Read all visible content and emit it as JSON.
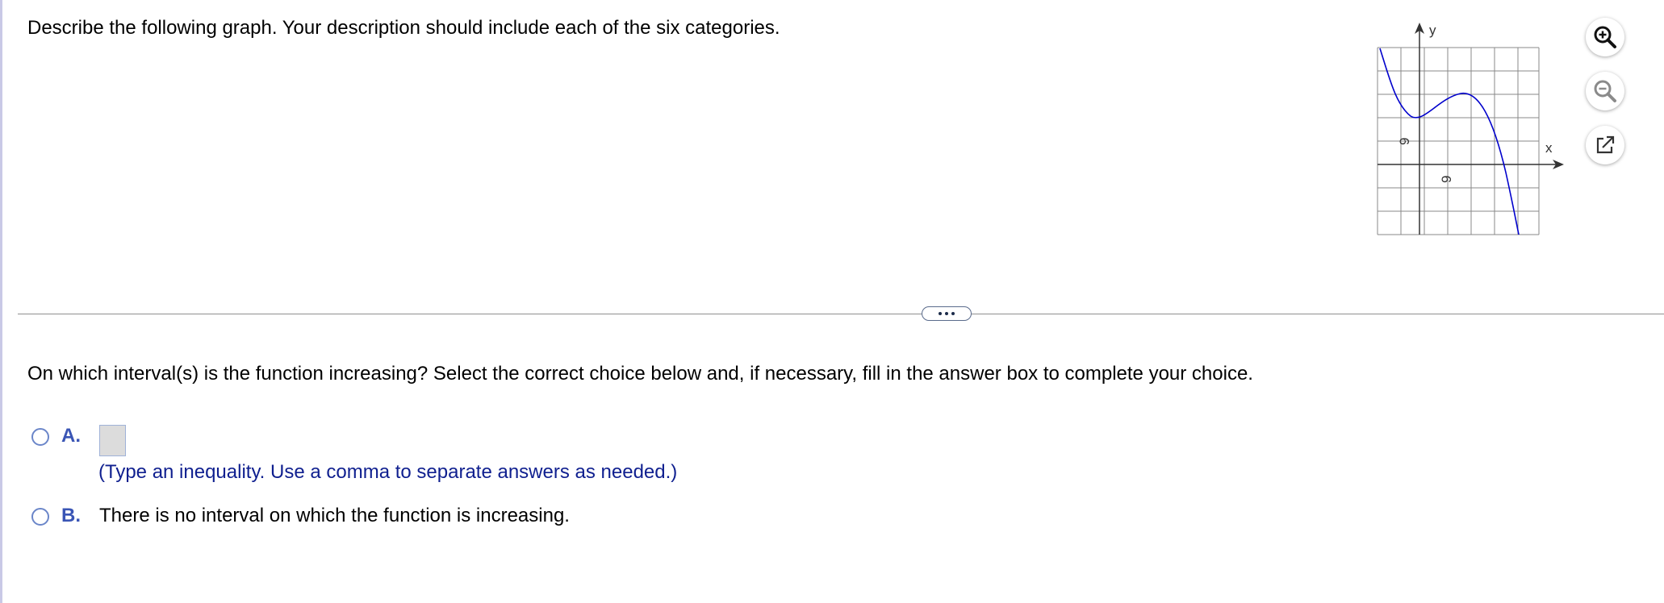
{
  "prompt": "Describe the following graph. Your description should include each of the six categories.",
  "graph": {
    "y_axis_label": "y",
    "x_axis_label": "x",
    "x_tick_label": "9",
    "y_tick_label": "9",
    "curve_color": "#0000cc",
    "grid_color": "#888888",
    "axis_color": "#333333"
  },
  "toolbar": {
    "zoom_in_icon": "zoom-in-icon",
    "zoom_out_icon": "zoom-out-icon",
    "popout_icon": "popout-icon"
  },
  "question": "On which interval(s) is the function increasing? Select the correct choice below and, if necessary, fill in the answer box to complete your choice.",
  "choices": {
    "a": {
      "letter": "A.",
      "answer_value": "",
      "hint": "(Type an inequality. Use a comma to separate answers as needed.)"
    },
    "b": {
      "letter": "B.",
      "text": "There is no interval on which the function is increasing."
    }
  },
  "colors": {
    "accent": "#3a55b5",
    "hint_text": "#0f1f8f",
    "radio_border": "#6b86c9"
  }
}
